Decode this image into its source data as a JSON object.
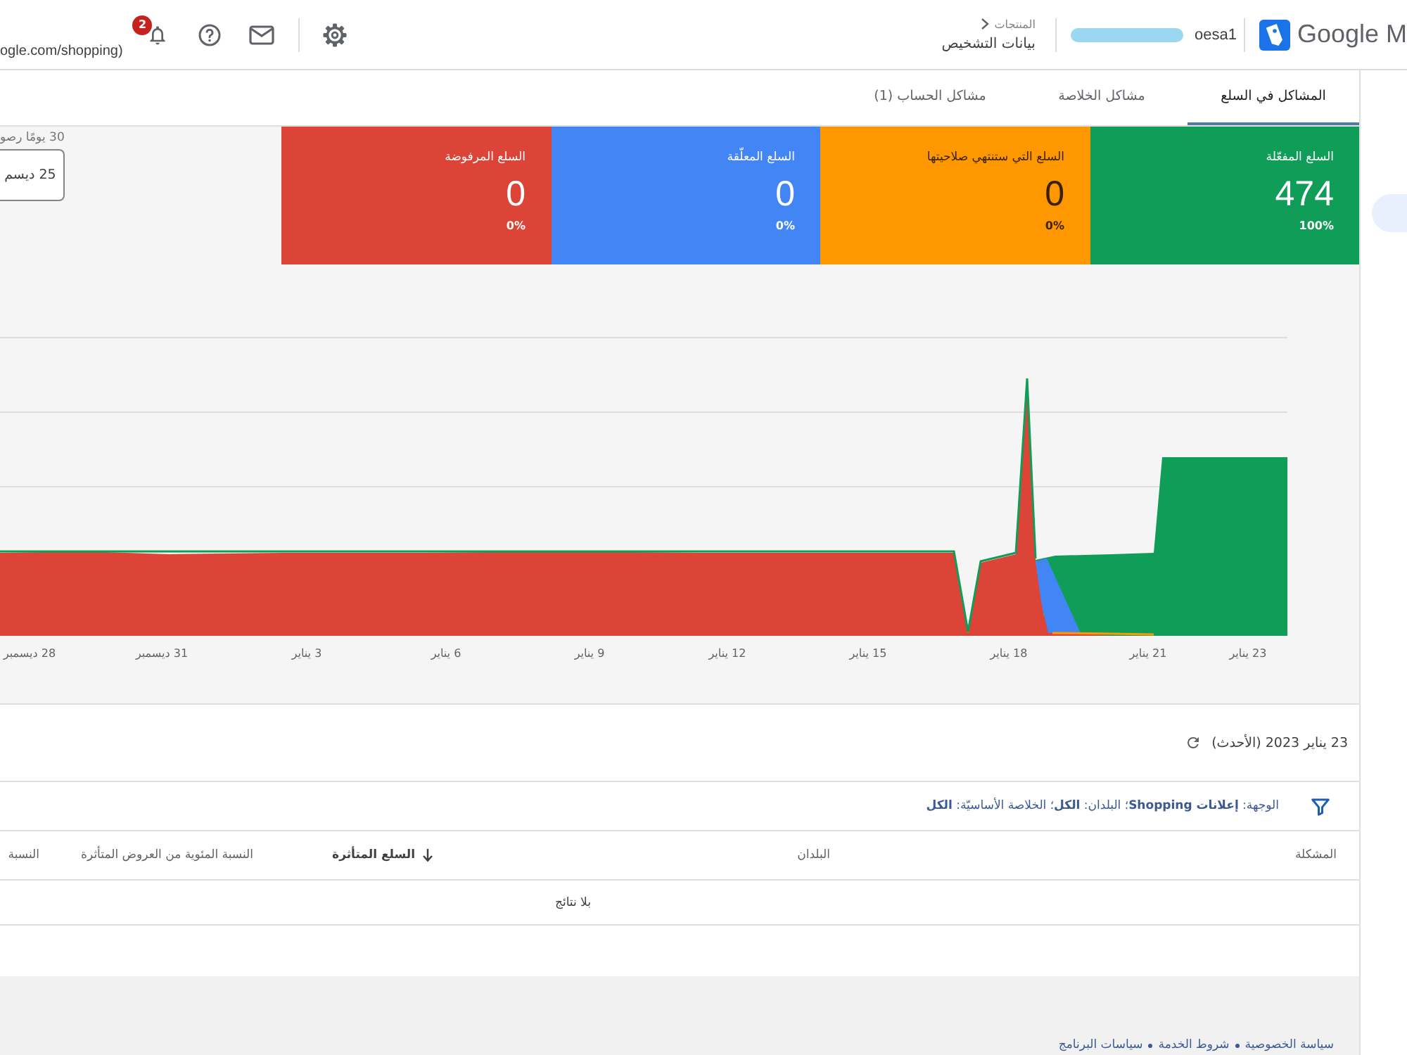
{
  "top_bar": {
    "logo": "Google M",
    "account_name": "oesa1",
    "breadcrumb": {
      "parent": "المنتجات",
      "current": "بيانات التشخيص"
    },
    "notification_count": "2",
    "url_fragment": "ogle.com/shopping)"
  },
  "tabs": [
    {
      "label": "المشاكل في السلع",
      "selected": true
    },
    {
      "label": "مشاكل الخلاصة",
      "selected": false
    },
    {
      "label": "مشاكل الحساب (1)",
      "selected": false
    }
  ],
  "cards": [
    {
      "label": "السلع المفعّلة",
      "value": "474",
      "percent": "100%",
      "color": "#0f9d58"
    },
    {
      "label": "السلع التي ستنتهي صلاحيتها",
      "value": "0",
      "percent": "0%",
      "color": "#ff9800"
    },
    {
      "label": "السلع المعلّقة",
      "value": "0",
      "percent": "0%",
      "color": "#4285f4"
    },
    {
      "label": "السلع المرفوضة",
      "value": "0",
      "percent": "0%",
      "color": "#db4437"
    }
  ],
  "date_range": {
    "caption": "30 يومًا رصو",
    "button": "25 ديسم"
  },
  "chart": {
    "x_labels": [
      "23 يناير",
      "21 يناير",
      "18 يناير",
      "15 يناير",
      "12 يناير",
      "9 يناير",
      "6 يناير",
      "3 يناير",
      "31 ديسمبر",
      "28 ديسمبر"
    ]
  },
  "snapshot": {
    "date": "23 يناير 2023 (الأحدث)"
  },
  "filter": {
    "text": "الوجهة: **إعلانات Shopping**؛ البلدان: **الكل**؛ الخلاصة الأساسيّة: **الكل**"
  },
  "table": {
    "columns": [
      {
        "label": "المشكلة",
        "sorted": false
      },
      {
        "label": "البلدان",
        "sorted": false
      },
      {
        "label": "السلع المتأثرة",
        "sorted": true
      },
      {
        "label": "النسبة المئوية من العروض المتأثرة",
        "sorted": false
      },
      {
        "label": "النسبة",
        "sorted": false
      }
    ],
    "empty_message": "بلا نتائج"
  },
  "footer": {
    "links": [
      "سياسة الخصوصية",
      "شروط الخدمة",
      "سياسات البرنامج"
    ]
  }
}
